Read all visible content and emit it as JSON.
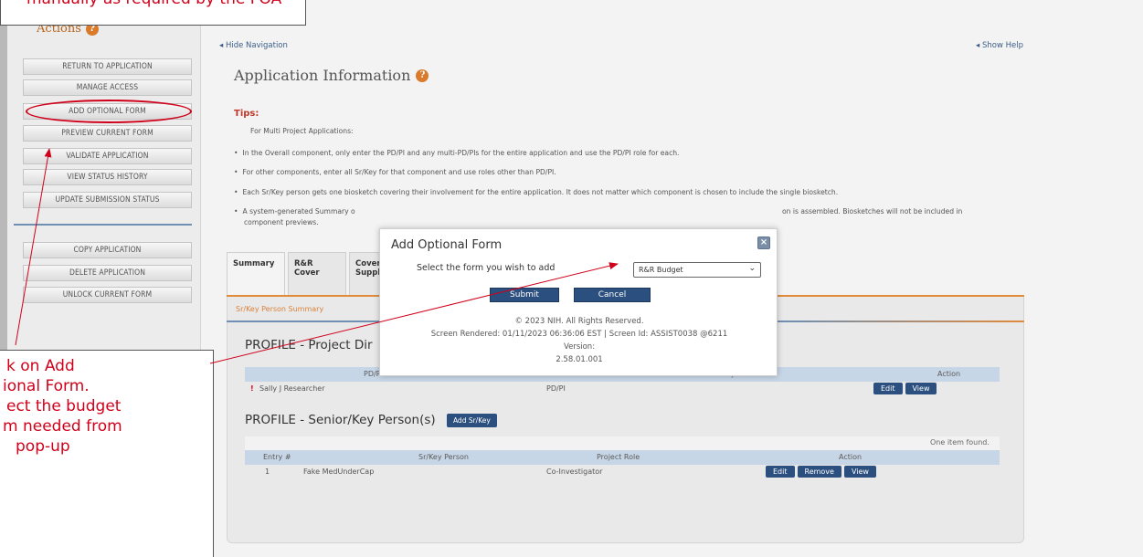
{
  "callouts": {
    "top": "manually as required by the FOA",
    "bottom": [
      "k on Add",
      "ional Form.",
      "ect the budget",
      "m needed from",
      "pop-up"
    ]
  },
  "sidebar": {
    "title": "Actions",
    "buttons": [
      "RETURN TO APPLICATION",
      "MANAGE ACCESS",
      "ADD OPTIONAL FORM",
      "PREVIEW CURRENT FORM",
      "VALIDATE APPLICATION",
      "VIEW STATUS HISTORY",
      "UPDATE SUBMISSION STATUS"
    ],
    "buttons2": [
      "COPY APPLICATION",
      "DELETE APPLICATION",
      "UNLOCK CURRENT FORM"
    ]
  },
  "header": {
    "hide_nav": "◂ Hide Navigation",
    "show_help": "◂ Show Help",
    "title": "Application Information"
  },
  "tips": {
    "label": "Tips:",
    "intro": "For Multi Project Applications:",
    "items": [
      "In the Overall component, only enter the PD/PI and any multi-PD/PIs for the entire application and use the PD/PI role for each.",
      "For other components, enter all Sr/Key for that component and use roles other than PD/PI.",
      "Each Sr/Key person gets one biosketch covering their involvement for the entire application. It does not matter which component is chosen to include the single biosketch.",
      "A system-generated Summary o",
      "component previews."
    ],
    "item4_tail": "on is assembled. Biosketches will not be included in"
  },
  "tabs": [
    "Summary",
    "R&R Cover",
    "Cover Supple"
  ],
  "subnav": "Sr/Key Person Summary",
  "pd_section": {
    "title": "PROFILE - Project Dir",
    "headers": [
      "PD/PI Name",
      "Project Role",
      "Action"
    ],
    "row": {
      "marker": "!",
      "name": "Sally J Researcher",
      "role": "PD/PI"
    },
    "actions": [
      "Edit",
      "View"
    ]
  },
  "senior_section": {
    "title": "PROFILE - Senior/Key Person(s)",
    "add_button": "Add Sr/Key",
    "found": "One item found.",
    "headers": [
      "Entry #",
      "Sr/Key Person",
      "Project Role",
      "Action"
    ],
    "row": {
      "entry": "1",
      "name": "Fake MedUnderCap",
      "role": "Co-Investigator"
    },
    "actions": [
      "Edit",
      "Remove",
      "View"
    ]
  },
  "modal": {
    "title": "Add Optional Form",
    "label": "Select the form you wish to add",
    "selected": "R&R Budget",
    "submit": "Submit",
    "cancel": "Cancel",
    "copyright": "© 2023 NIH. All Rights Reserved.",
    "rendered": "Screen Rendered: 01/11/2023 06:36:06 EST | Screen Id: ASSIST0038 @6211",
    "version_label": "Version:",
    "version": "2.58.01.001"
  },
  "colors": {
    "accent_red": "#d0021b",
    "button_blue": "#2b4f7e",
    "orange": "#e08a3c"
  }
}
